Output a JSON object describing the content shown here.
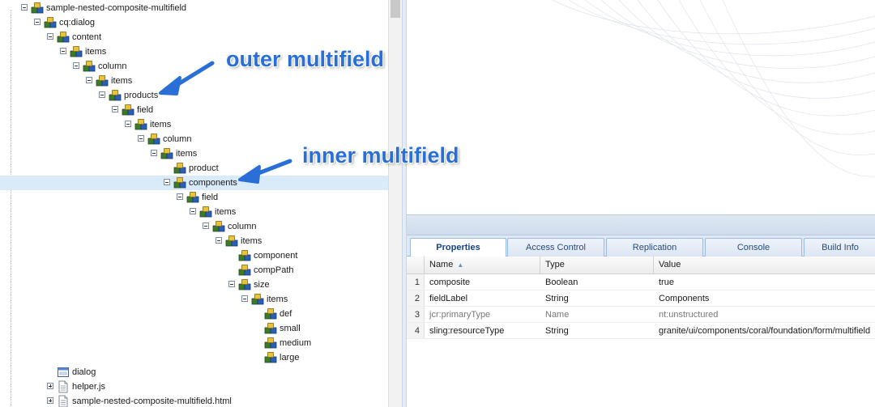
{
  "tree": {
    "nodes": [
      {
        "label": "sample-nested-composite-multifield",
        "depth": 0,
        "toggle": "minus",
        "icon": "node"
      },
      {
        "label": "cq:dialog",
        "depth": 1,
        "toggle": "minus",
        "icon": "node"
      },
      {
        "label": "content",
        "depth": 2,
        "toggle": "minus",
        "icon": "node"
      },
      {
        "label": "items",
        "depth": 3,
        "toggle": "minus",
        "icon": "node"
      },
      {
        "label": "column",
        "depth": 4,
        "toggle": "minus",
        "icon": "node"
      },
      {
        "label": "items",
        "depth": 5,
        "toggle": "minus",
        "icon": "node"
      },
      {
        "label": "products",
        "depth": 6,
        "toggle": "minus",
        "icon": "node"
      },
      {
        "label": "field",
        "depth": 7,
        "toggle": "minus",
        "icon": "node"
      },
      {
        "label": "items",
        "depth": 8,
        "toggle": "minus",
        "icon": "node"
      },
      {
        "label": "column",
        "depth": 9,
        "toggle": "minus",
        "icon": "node"
      },
      {
        "label": "items",
        "depth": 10,
        "toggle": "minus",
        "icon": "node"
      },
      {
        "label": "product",
        "depth": 11,
        "toggle": "none",
        "icon": "node"
      },
      {
        "label": "components",
        "depth": 11,
        "toggle": "minus",
        "icon": "node",
        "selected": true
      },
      {
        "label": "field",
        "depth": 12,
        "toggle": "minus",
        "icon": "node"
      },
      {
        "label": "items",
        "depth": 13,
        "toggle": "minus",
        "icon": "node"
      },
      {
        "label": "column",
        "depth": 14,
        "toggle": "minus",
        "icon": "node"
      },
      {
        "label": "items",
        "depth": 15,
        "toggle": "minus",
        "icon": "node"
      },
      {
        "label": "component",
        "depth": 16,
        "toggle": "none",
        "icon": "node"
      },
      {
        "label": "compPath",
        "depth": 16,
        "toggle": "none",
        "icon": "node"
      },
      {
        "label": "size",
        "depth": 16,
        "toggle": "minus",
        "icon": "node"
      },
      {
        "label": "items",
        "depth": 17,
        "toggle": "minus",
        "icon": "node"
      },
      {
        "label": "def",
        "depth": 18,
        "toggle": "none",
        "icon": "node"
      },
      {
        "label": "small",
        "depth": 18,
        "toggle": "none",
        "icon": "node"
      },
      {
        "label": "medium",
        "depth": 18,
        "toggle": "none",
        "icon": "node"
      },
      {
        "label": "large",
        "depth": 18,
        "toggle": "none",
        "icon": "node"
      },
      {
        "label": "dialog",
        "depth": 2,
        "toggle": "none",
        "icon": "dialog",
        "gapBefore": true
      },
      {
        "label": "helper.js",
        "depth": 2,
        "toggle": "plus",
        "icon": "file"
      },
      {
        "label": "sample-nested-composite-multifield.html",
        "depth": 2,
        "toggle": "plus",
        "icon": "file"
      }
    ]
  },
  "annotations": {
    "outer": "outer multifield",
    "inner": "inner multifield"
  },
  "tabs": [
    {
      "label": "Properties",
      "active": true
    },
    {
      "label": "Access Control",
      "active": false
    },
    {
      "label": "Replication",
      "active": false
    },
    {
      "label": "Console",
      "active": false
    },
    {
      "label": "Build Info",
      "active": false
    }
  ],
  "grid": {
    "columns": [
      "Name",
      "Type",
      "Value"
    ],
    "sort_indicator": "▲",
    "rows": [
      {
        "num": "1",
        "name": "composite",
        "type": "Boolean",
        "value": "true",
        "protected": false
      },
      {
        "num": "2",
        "name": "fieldLabel",
        "type": "String",
        "value": "Components",
        "protected": false
      },
      {
        "num": "3",
        "name": "jcr:primaryType",
        "type": "Name",
        "value": "nt:unstructured",
        "protected": true
      },
      {
        "num": "4",
        "name": "sling:resourceType",
        "type": "String",
        "value": "granite/ui/components/coral/foundation/form/multifield",
        "protected": false
      }
    ]
  },
  "colors": {
    "accent": "#2a6fd8",
    "selection": "#d9eaf9",
    "tab_border": "#99bbe8"
  }
}
